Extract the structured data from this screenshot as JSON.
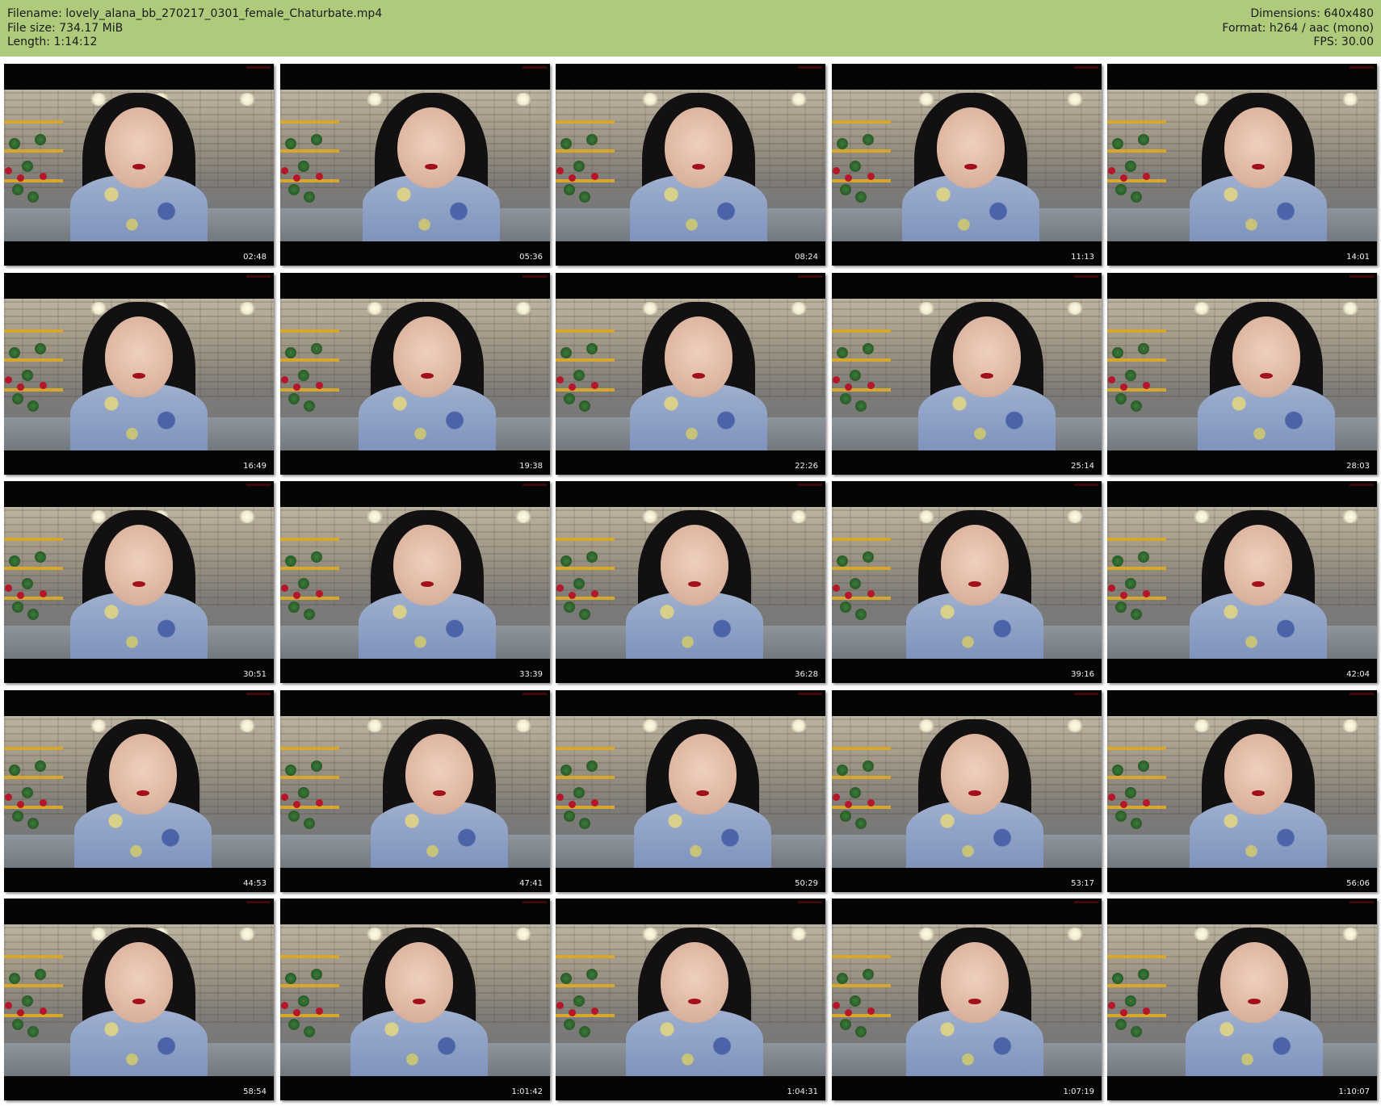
{
  "header": {
    "filename_line": "Filename: lovely_alana_bb_270217_0301_female_Chaturbate.mp4",
    "filesize_line": "File size: 734.17 MiB",
    "length_line": "Length: 1:14:12",
    "dimensions_line": "Dimensions: 640x480",
    "format_line": "Format: h264 / aac (mono)",
    "fps_line": "FPS: 30.00"
  },
  "colors": {
    "header_background": "#aecb7c",
    "thumbnail_border": "#050505",
    "timestamp_text": "#f0f0f0"
  },
  "thumbnails": [
    "02:48",
    "05:36",
    "08:24",
    "11:13",
    "14:01",
    "16:49",
    "19:38",
    "22:26",
    "25:14",
    "28:03",
    "30:51",
    "33:39",
    "36:28",
    "39:16",
    "42:04",
    "44:53",
    "47:41",
    "50:29",
    "53:17",
    "56:06",
    "58:54",
    "1:01:42",
    "1:04:31",
    "1:07:19",
    "1:10:07"
  ]
}
